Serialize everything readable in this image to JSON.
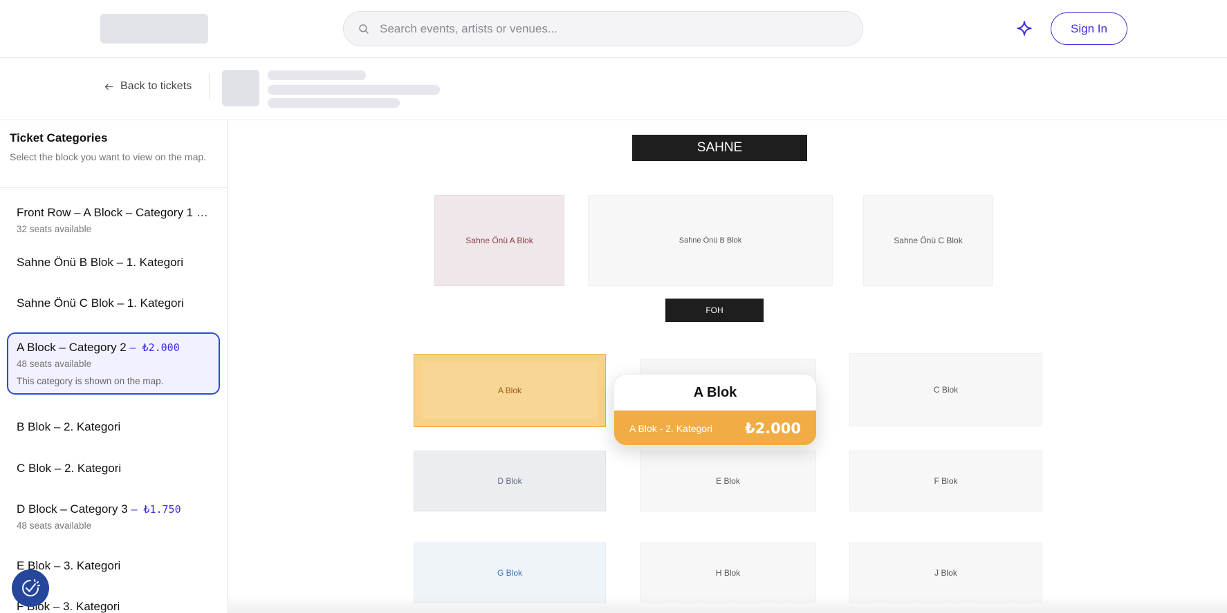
{
  "header": {
    "search_placeholder": "Search events, artists or venues...",
    "signin_label": "Sign In",
    "icons": {
      "search": "search-icon",
      "sparkle": "sparkle-icon"
    }
  },
  "subheader": {
    "back_label": "Back to tickets"
  },
  "sidebar": {
    "title": "Ticket Categories",
    "description": "Select the block you want to view on the map.",
    "categories": [
      {
        "name": "Front Row – A Block – Category 1",
        "price": "– ...",
        "seats": "32 seats available"
      },
      {
        "name": "Sahne Önü B Blok – 1. Kategori"
      },
      {
        "name": "Sahne Önü C Blok – 1. Kategori"
      },
      {
        "name": "A Block – Category 2",
        "price": "– ₺2.000",
        "seats": "48 seats available",
        "note": "This category is shown on the map."
      },
      {
        "name": "B Blok – 2. Kategori"
      },
      {
        "name": "C Blok – 2. Kategori"
      },
      {
        "name": "D Block – Category 3",
        "price": "– ₺1.750",
        "seats": "48 seats available"
      },
      {
        "name": "E Blok – 3. Kategori"
      },
      {
        "name": "F Blok – 3. Kategori"
      }
    ]
  },
  "map": {
    "stage_label": "SAHNE",
    "foh_label": "FOH",
    "blocks": {
      "sahne_a": "Sahne Önü A Blok",
      "sahne_b": "Sahne Önü B Blok",
      "sahne_c": "Sahne Önü C Blok",
      "a": "A Blok",
      "c": "C Blok",
      "d": "D Blok",
      "e": "E Blok",
      "f": "F Blok",
      "g": "G Blok",
      "h": "H Blok",
      "j": "J Blok"
    },
    "tooltip": {
      "title": "A Blok",
      "category": "A Blok - 2. Kategori",
      "price": "₺2.000"
    }
  },
  "colors": {
    "accent": "#3d2ee0",
    "selected_border": "#2e4bd1",
    "selected_block": "#f7d288",
    "tooltip_bar": "#f0ac45",
    "cookie_button": "#24469b"
  }
}
